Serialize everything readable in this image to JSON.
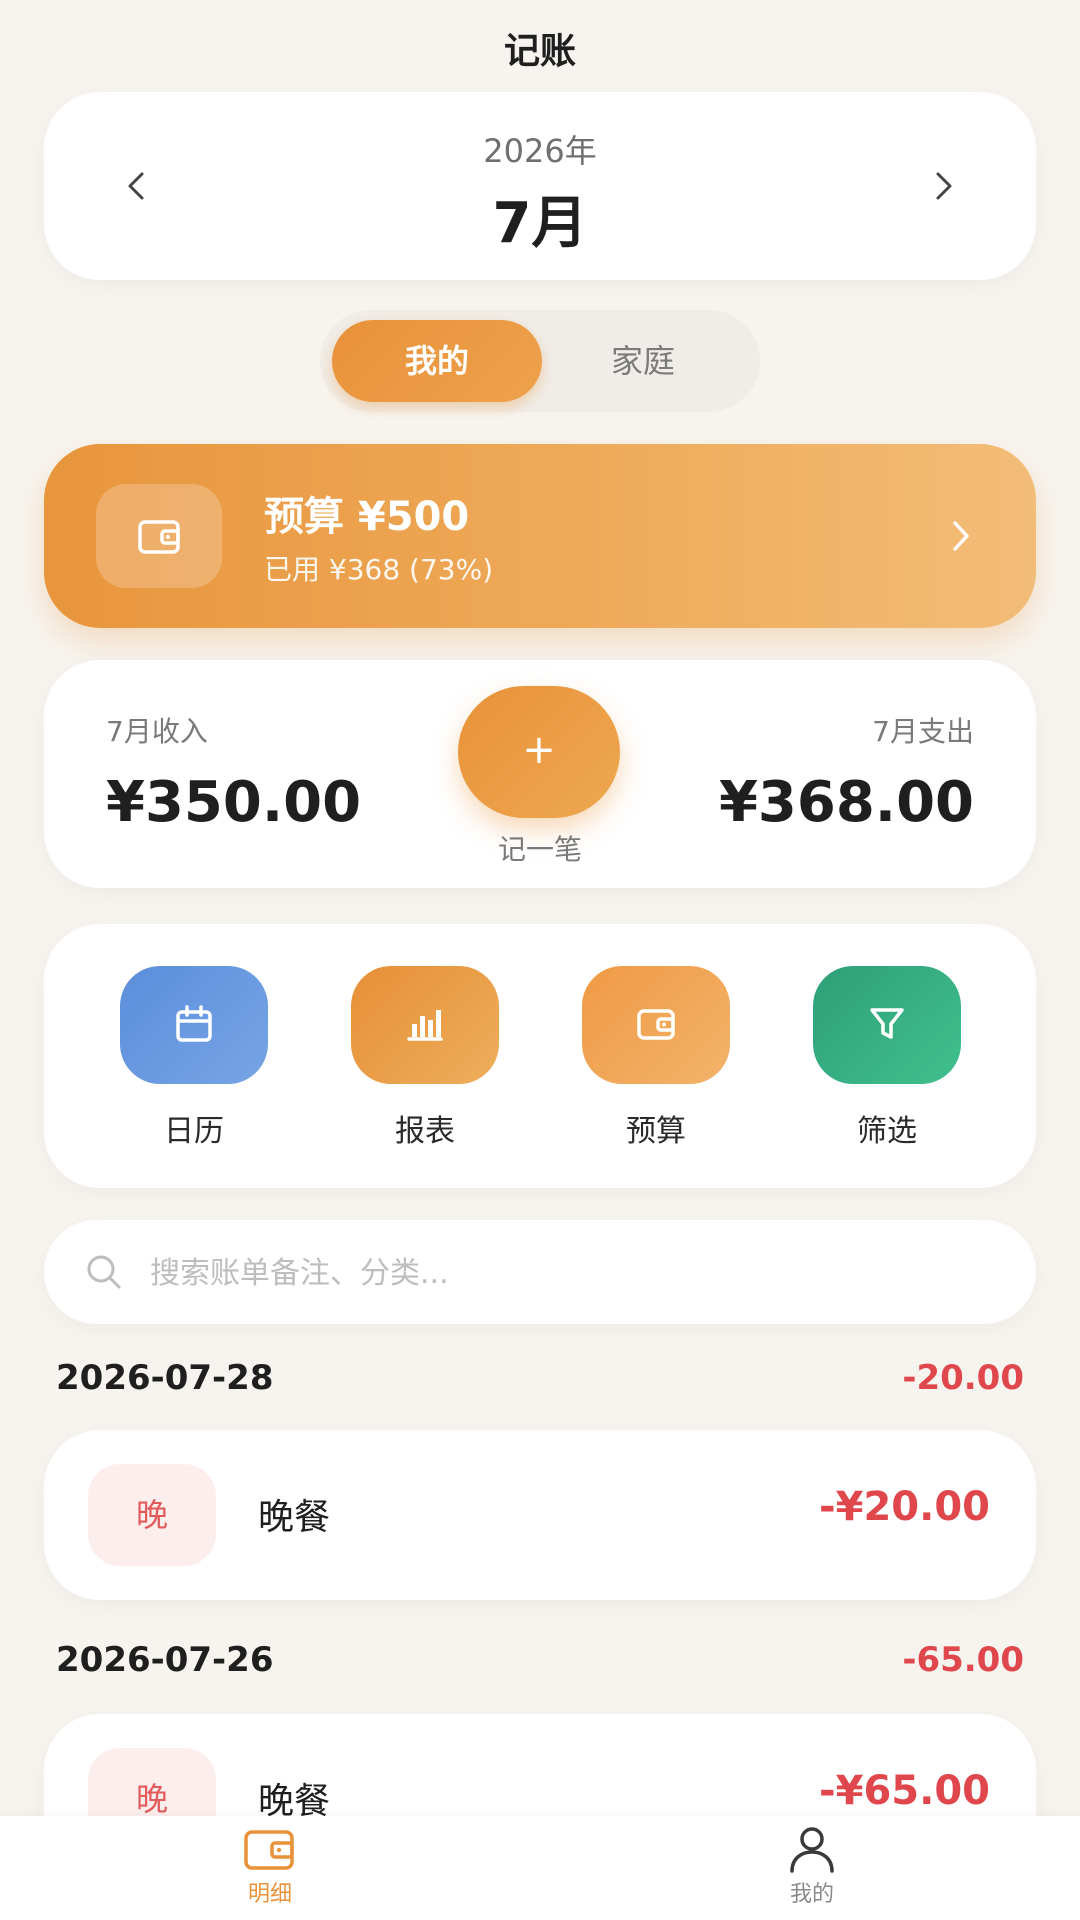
{
  "header": {
    "title": "记账"
  },
  "month_selector": {
    "year": "2026年",
    "month": "7月"
  },
  "scope_toggle": {
    "mine": "我的",
    "family": "家庭",
    "active": "我的"
  },
  "budget": {
    "title": "预算 ¥500",
    "subtitle": "已用 ¥368 (73%)",
    "used_fraction": 0.73
  },
  "summary": {
    "income_label": "7月收入",
    "income_value": "¥350.00",
    "expense_label": "7月支出",
    "expense_value": "¥368.00",
    "add_symbol": "+",
    "add_label": "记一笔"
  },
  "actions": [
    {
      "label": "日历",
      "icon": "calendar-icon"
    },
    {
      "label": "报表",
      "icon": "bar-chart-icon"
    },
    {
      "label": "预算",
      "icon": "wallet-icon"
    },
    {
      "label": "筛选",
      "icon": "filter-icon"
    }
  ],
  "search": {
    "placeholder": "搜索账单备注、分类..."
  },
  "groups": [
    {
      "date": "2026-07-28",
      "total": "-20.00",
      "entries": [
        {
          "category": "晚",
          "name": "晚餐",
          "amount": "-¥20.00"
        }
      ]
    },
    {
      "date": "2026-07-26",
      "total": "-65.00",
      "entries": [
        {
          "category": "晚",
          "name": "晚餐",
          "amount": "-¥65.00"
        }
      ]
    }
  ],
  "bottom_nav": [
    {
      "label": "明细",
      "icon": "wallet-icon",
      "active": true
    },
    {
      "label": "我的",
      "icon": "user-icon",
      "active": false
    }
  ],
  "colors": {
    "accent": "#e8923a",
    "expense": "#e0474c",
    "background": "#f7f4ef"
  }
}
